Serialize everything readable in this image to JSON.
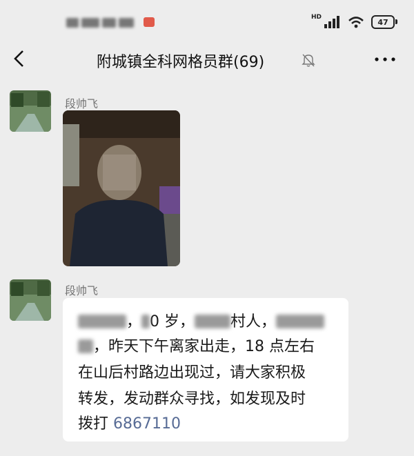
{
  "status_bar": {
    "network_label": "HD",
    "battery": "47"
  },
  "header": {
    "title": "附城镇全科网格员群(69)"
  },
  "messages": [
    {
      "sender": "段帅飞"
    },
    {
      "sender": "段帅飞",
      "text": {
        "age_text": "0 岁，",
        "village_text": "村人，",
        "segment_departure": "，昨天下午离家出走，18 点左右",
        "line_3": "在山后村路边出现过，请大家积极",
        "line_4": "转发，发动群众寻找，如发现及时",
        "line_5_prefix": "拨打 ",
        "phone": "6867110"
      }
    }
  ]
}
